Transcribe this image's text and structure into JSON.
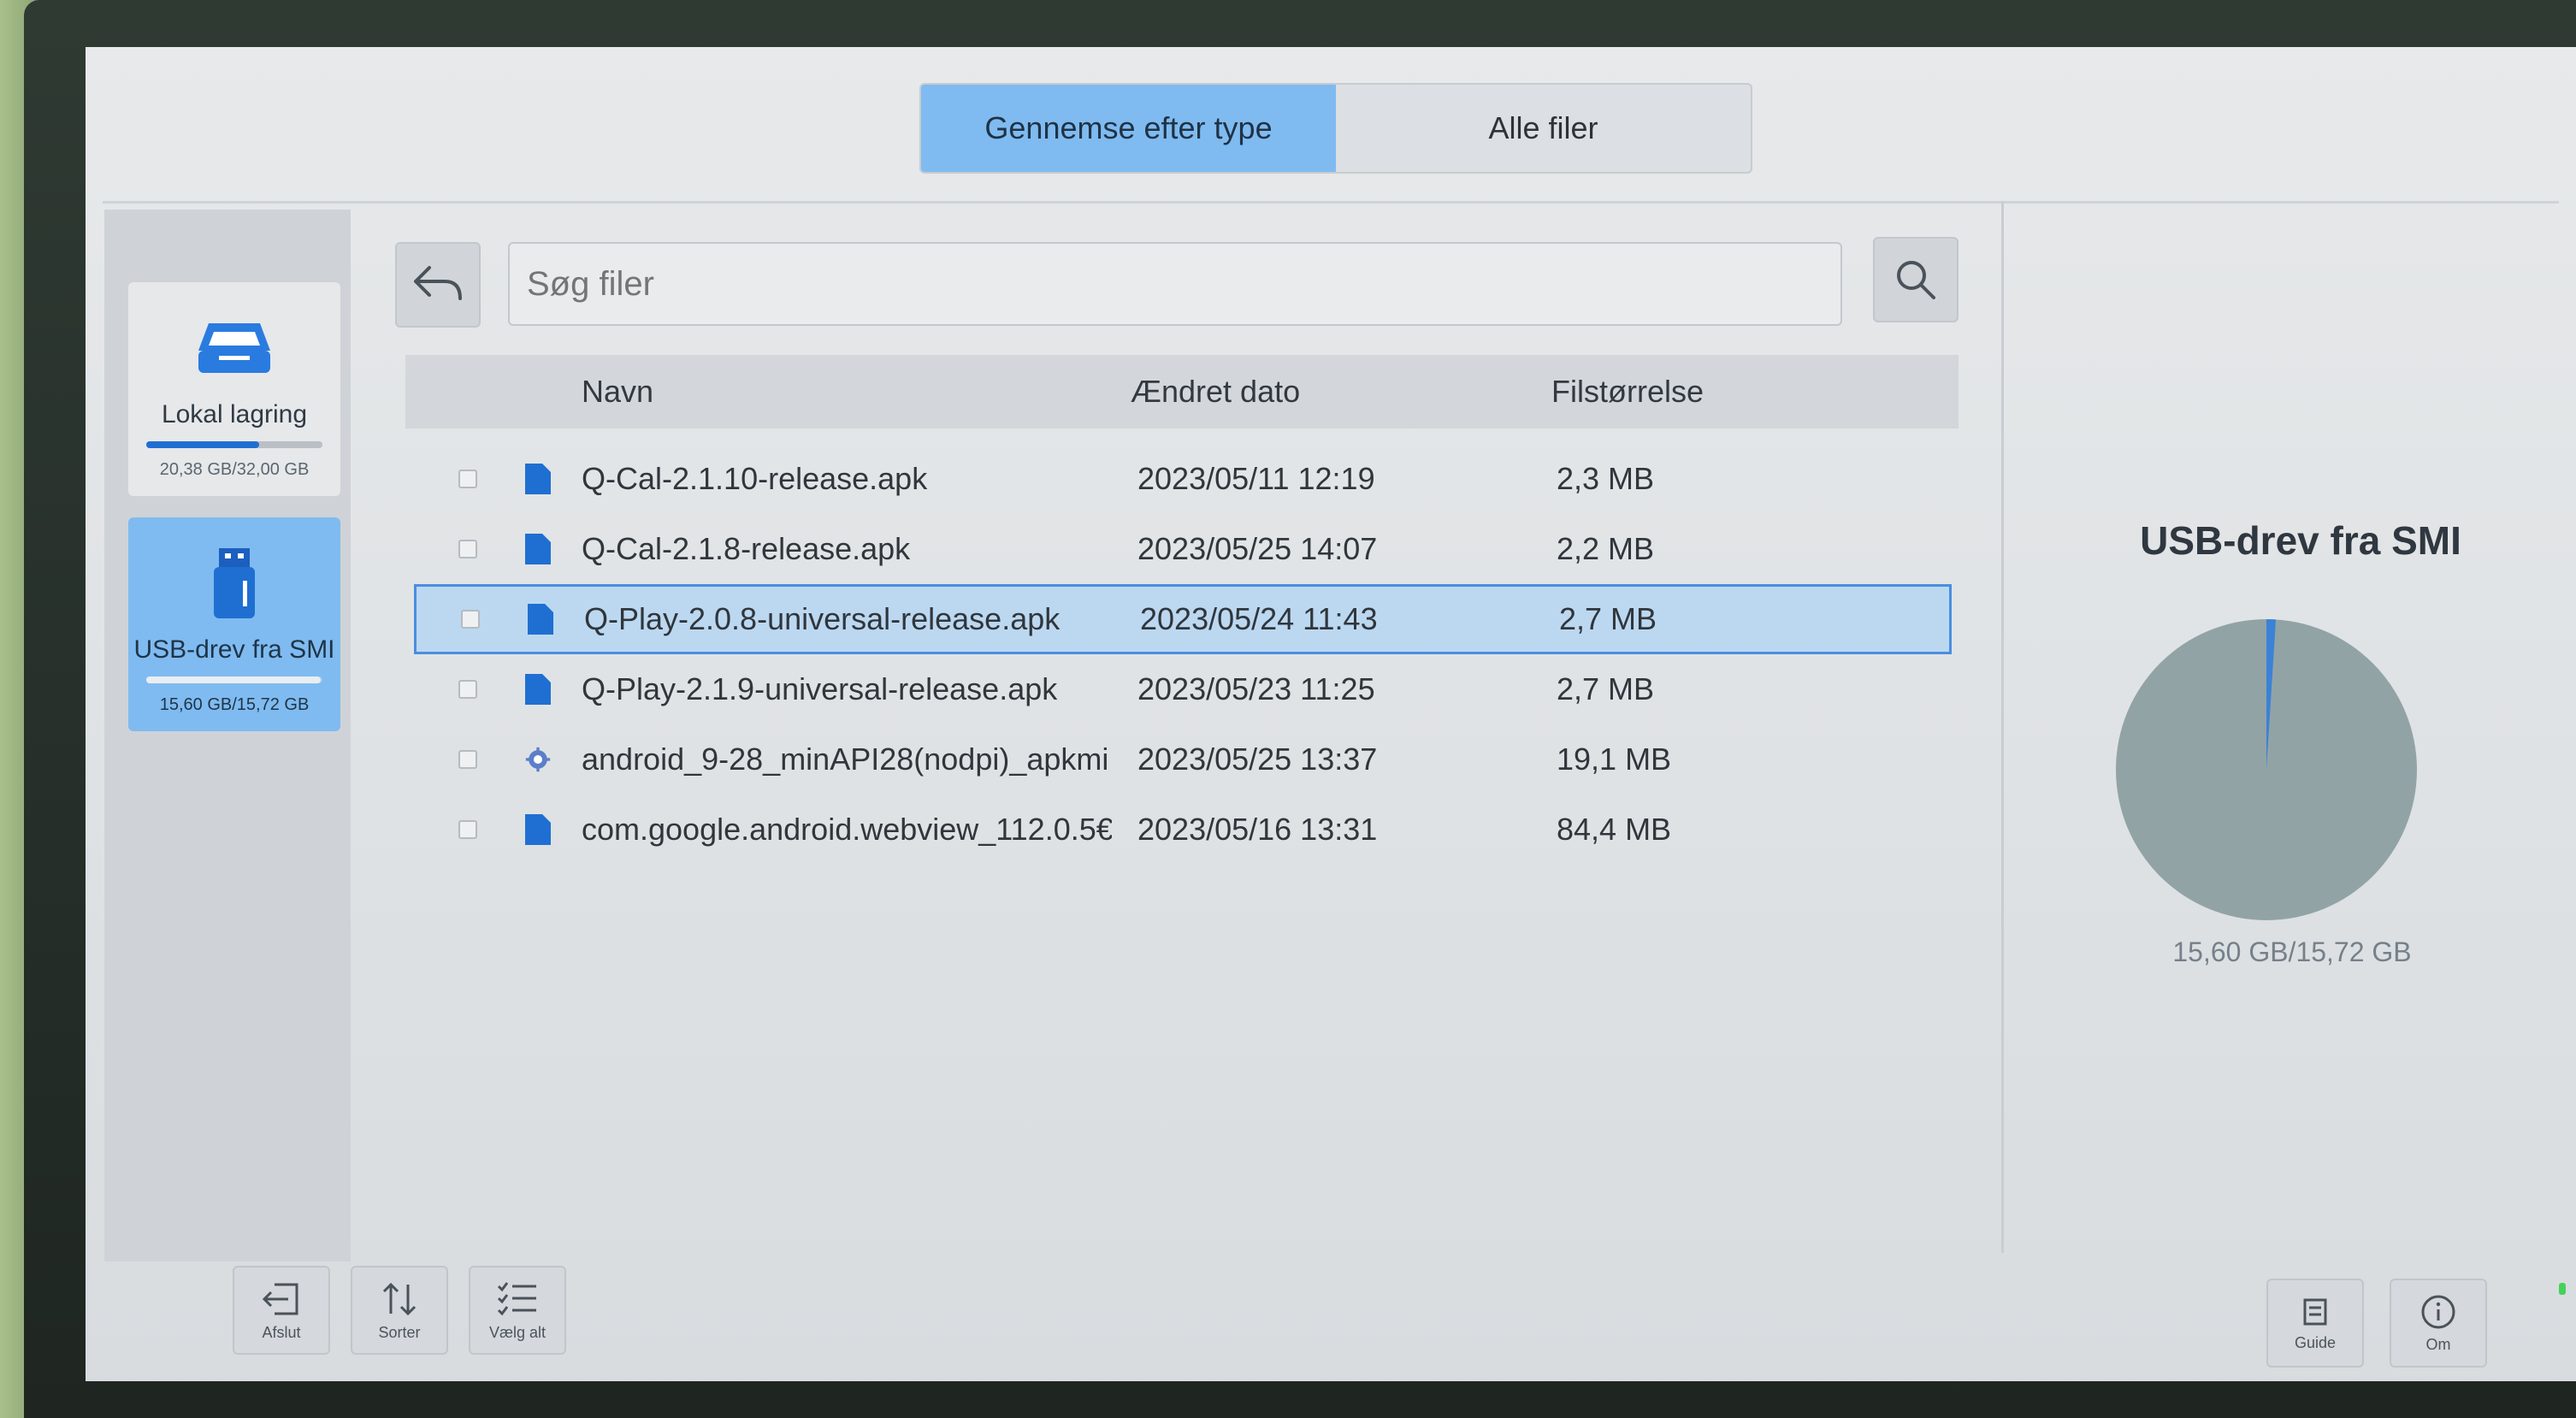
{
  "tabs": [
    {
      "label": "Gennemse efter type",
      "active": true
    },
    {
      "label": "Alle filer",
      "active": false
    }
  ],
  "sidebar": {
    "drives": [
      {
        "name": "Lokal lagring",
        "usage": "20,38 GB/32,00 GB",
        "used_fraction": 0.64,
        "icon": "hard-drive-icon",
        "selected": false
      },
      {
        "name": "USB-drev fra SMI",
        "usage": "15,60 GB/15,72 GB",
        "used_fraction": 0.99,
        "icon": "usb-drive-icon",
        "selected": true
      }
    ]
  },
  "search": {
    "placeholder": "Søg filer",
    "value": ""
  },
  "table": {
    "headers": {
      "name": "Navn",
      "date": "Ændret dato",
      "size": "Filstørrelse"
    },
    "rows": [
      {
        "name": "Q-Cal-2.1.10-release.apk",
        "date": "2023/05/11 12:19",
        "size": "2,3 MB",
        "icon": "file-icon",
        "selected": false
      },
      {
        "name": "Q-Cal-2.1.8-release.apk",
        "date": "2023/05/25 14:07",
        "size": "2,2 MB",
        "icon": "file-icon",
        "selected": false
      },
      {
        "name": "Q-Play-2.0.8-universal-release.apk",
        "date": "2023/05/24 11:43",
        "size": "2,7 MB",
        "icon": "file-icon",
        "selected": true
      },
      {
        "name": "Q-Play-2.1.9-universal-release.apk",
        "date": "2023/05/23 11:25",
        "size": "2,7 MB",
        "icon": "file-icon",
        "selected": false
      },
      {
        "name": "android_9-28_minAPI28(nodpi)_apkmi",
        "date": "2023/05/25 13:37",
        "size": "19,1 MB",
        "icon": "android-app-icon",
        "selected": false
      },
      {
        "name": "com.google.android.webview_112.0.5€",
        "date": "2023/05/16 13:31",
        "size": "84,4 MB",
        "icon": "file-icon",
        "selected": false
      }
    ]
  },
  "panel": {
    "title": "USB-drev fra SMI",
    "usage": "15,60 GB/15,72 GB",
    "used_fraction": 0.99,
    "colors": {
      "used": "#92a3a6",
      "free": "#3b82d6"
    }
  },
  "toolbar": {
    "left": [
      {
        "label": "Afslut",
        "icon": "exit-icon"
      },
      {
        "label": "Sorter",
        "icon": "sort-icon"
      },
      {
        "label": "Vælg alt",
        "icon": "select-all-icon"
      }
    ],
    "right": [
      {
        "label": "Guide",
        "icon": "guide-icon"
      },
      {
        "label": "Om",
        "icon": "info-icon"
      }
    ]
  }
}
